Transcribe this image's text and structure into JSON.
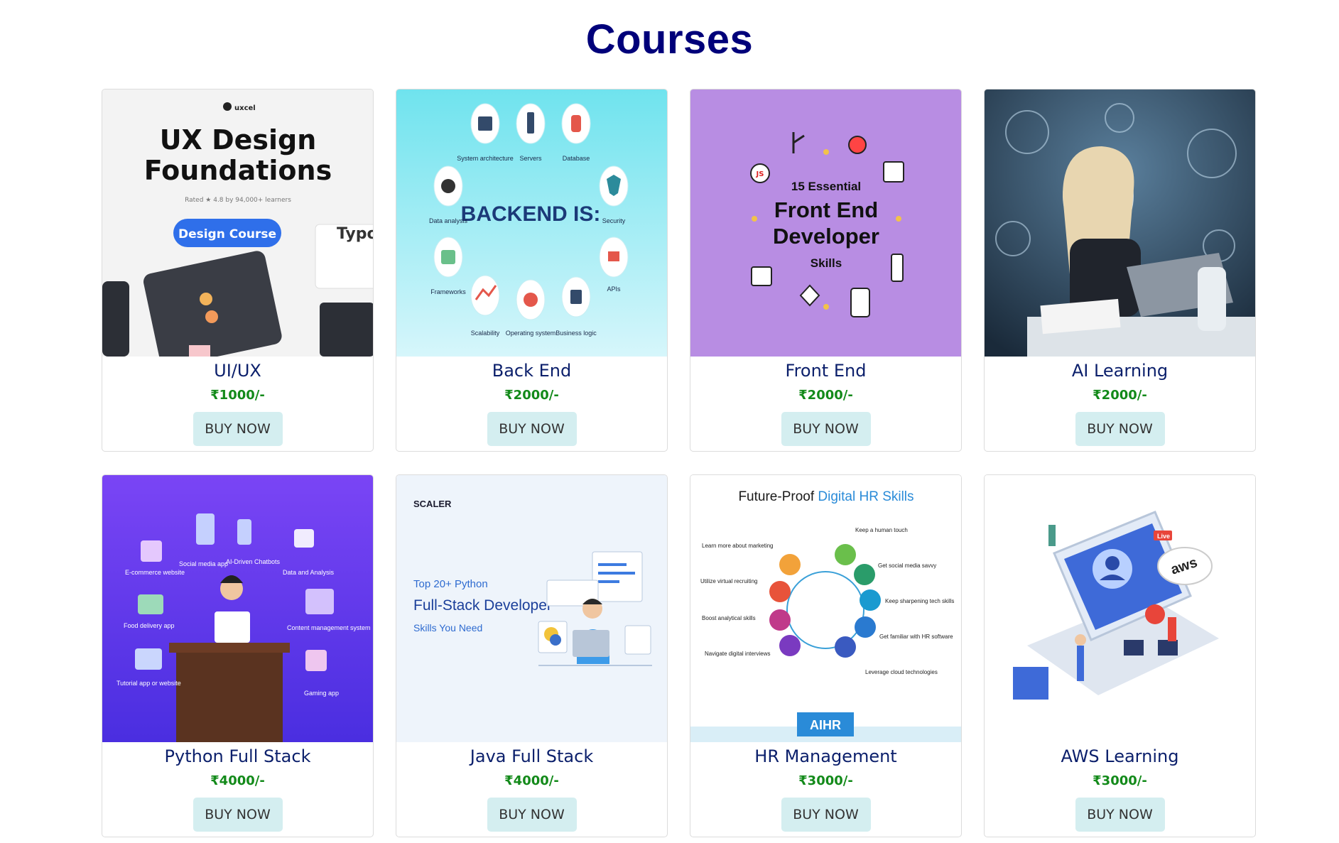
{
  "page": {
    "title": "Courses"
  },
  "buy_label": "BUY NOW",
  "courses": [
    {
      "name": "UI/UX",
      "price": "₹1000/-",
      "image": {
        "brand": "uxcel",
        "headline_1": "UX Design",
        "headline_2": "Foundations",
        "rating": "Rated ★ 4.8 by 94,000+ learners",
        "pill": "Design Course",
        "side_text": "Typo"
      }
    },
    {
      "name": "Back End",
      "price": "₹2000/-",
      "image": {
        "headline": "BACKEND IS:",
        "labels": [
          "System architecture",
          "Servers",
          "Database",
          "Data analysis",
          "Security",
          "Frameworks",
          "APIs",
          "Scalability",
          "Operating system",
          "Business logic"
        ]
      }
    },
    {
      "name": "Front End",
      "price": "₹2000/-",
      "image": {
        "line_1": "15 Essential",
        "line_2": "Front End",
        "line_3": "Developer",
        "line_4": "Skills"
      }
    },
    {
      "name": "AI Learning",
      "price": "₹2000/-",
      "image": {}
    },
    {
      "name": "Python Full Stack",
      "price": "₹4000/-",
      "image": {
        "labels": [
          "E-commerce website",
          "Social media app",
          "AI-Driven Chatbots",
          "Data and Analysis",
          "Food delivery app",
          "Content management system",
          "Tutorial app or website",
          "Gaming app"
        ]
      }
    },
    {
      "name": "Java Full Stack",
      "price": "₹4000/-",
      "image": {
        "brand": "SCALER",
        "line_1": "Top 20+ Python",
        "line_2": "Full-Stack Developer",
        "line_3": "Skills You Need"
      }
    },
    {
      "name": "HR Management",
      "price": "₹3000/-",
      "image": {
        "title_1": "Future-Proof ",
        "title_2": "Digital HR Skills",
        "labels_left": [
          "Learn more about marketing",
          "Utilize virtual recruiting",
          "Boost analytical skills",
          "Navigate digital interviews"
        ],
        "labels_right": [
          "Keep a human touch",
          "Get social media savvy",
          "Keep sharpening tech skills",
          "Get familiar with HR software",
          "Leverage cloud technologies"
        ],
        "footer": "AIHR"
      }
    },
    {
      "name": "AWS Learning",
      "price": "₹3000/-",
      "image": {
        "badge": "Live",
        "logo": "aws"
      }
    }
  ],
  "colors": {
    "title": "#00007a",
    "course_name": "#0b1f6b",
    "price": "#138a1a",
    "button_bg": "#d4eef0"
  }
}
